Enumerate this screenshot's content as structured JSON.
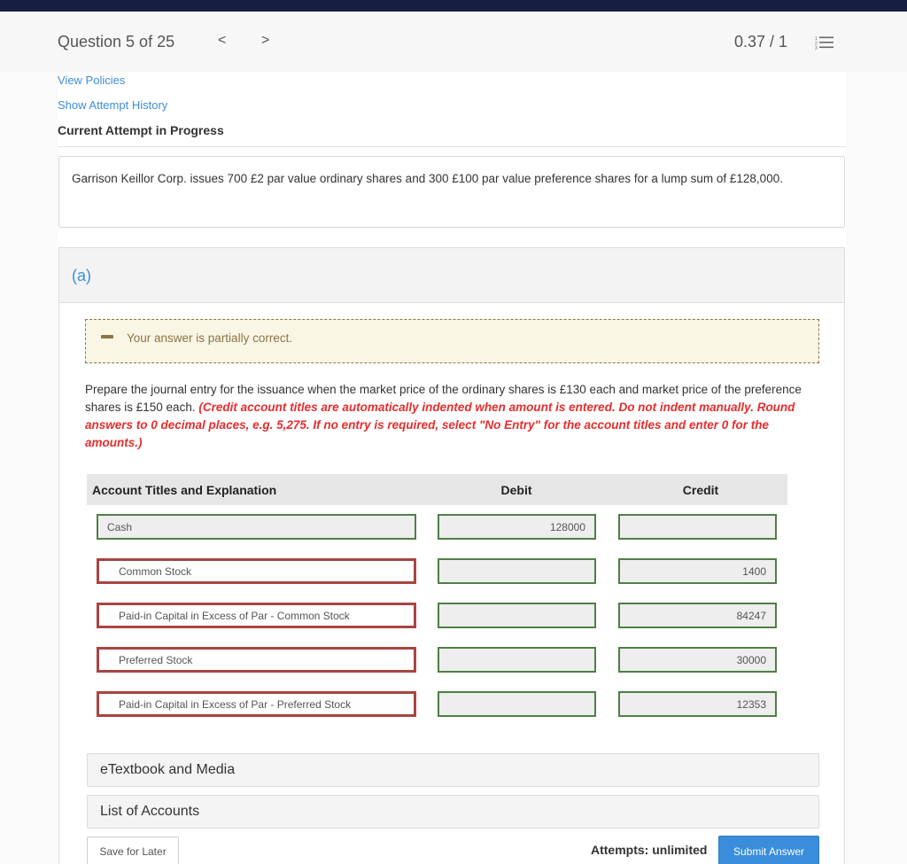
{
  "header": {
    "question_label": "Question 5 of 25",
    "prev_icon": "chevron-left-icon",
    "prev_glyph": "<",
    "next_icon": "chevron-right-icon",
    "next_glyph": ">",
    "score": "0.37 / 1",
    "list_icon": "numbered-list-icon"
  },
  "links": {
    "view_policies": "View Policies",
    "show_attempt_history": "Show Attempt History"
  },
  "current_attempt_label": "Current Attempt in Progress",
  "question_stem": "Garrison Keillor Corp. issues 700 £2 par value ordinary shares and 300 £100 par value preference shares for a lump sum of £128,000.",
  "part": {
    "label": "(a)",
    "feedback": {
      "icon": "minus-icon",
      "text": "Your answer is partially correct."
    },
    "instructions_plain": "Prepare the journal entry for the issuance when the market price of the ordinary shares is £130 each and market price of the preference shares is £150 each. ",
    "instructions_red": "(Credit account titles are automatically indented when amount is entered. Do not indent manually. Round answers to 0 decimal places, e.g. 5,275. If no entry is required, select \"No Entry\" for the account titles and enter 0 for the amounts.)",
    "table": {
      "headers": {
        "account": "Account Titles and Explanation",
        "debit": "Debit",
        "credit": "Credit"
      },
      "rows": [
        {
          "account": "Cash",
          "debit": "128000",
          "credit": "",
          "account_status": "correct"
        },
        {
          "account": "Common Stock",
          "debit": "",
          "credit": "1400",
          "account_status": "incorrect"
        },
        {
          "account": "Paid-in Capital in Excess of Par - Common Stock",
          "debit": "",
          "credit": "84247",
          "account_status": "incorrect"
        },
        {
          "account": "Preferred Stock",
          "debit": "",
          "credit": "30000",
          "account_status": "incorrect"
        },
        {
          "account": "Paid-in Capital in Excess of Par - Preferred Stock",
          "debit": "",
          "credit": "12353",
          "account_status": "incorrect"
        }
      ]
    },
    "resources": [
      "eTextbook and Media",
      "List of Accounts"
    ],
    "save_label": "Save for Later",
    "attempts_label": "Attempts: unlimited",
    "submit_label": "Submit Answer"
  },
  "colors": {
    "topbar": "#161f42",
    "link": "#3f8ed8",
    "correct_border": "#4f7f45",
    "incorrect_border": "#a94442",
    "feedback_text": "#8c7447",
    "feedback_bg": "#faf6e5",
    "instruction_red": "#e52d2d",
    "submit_bg": "#3a8ddb"
  }
}
